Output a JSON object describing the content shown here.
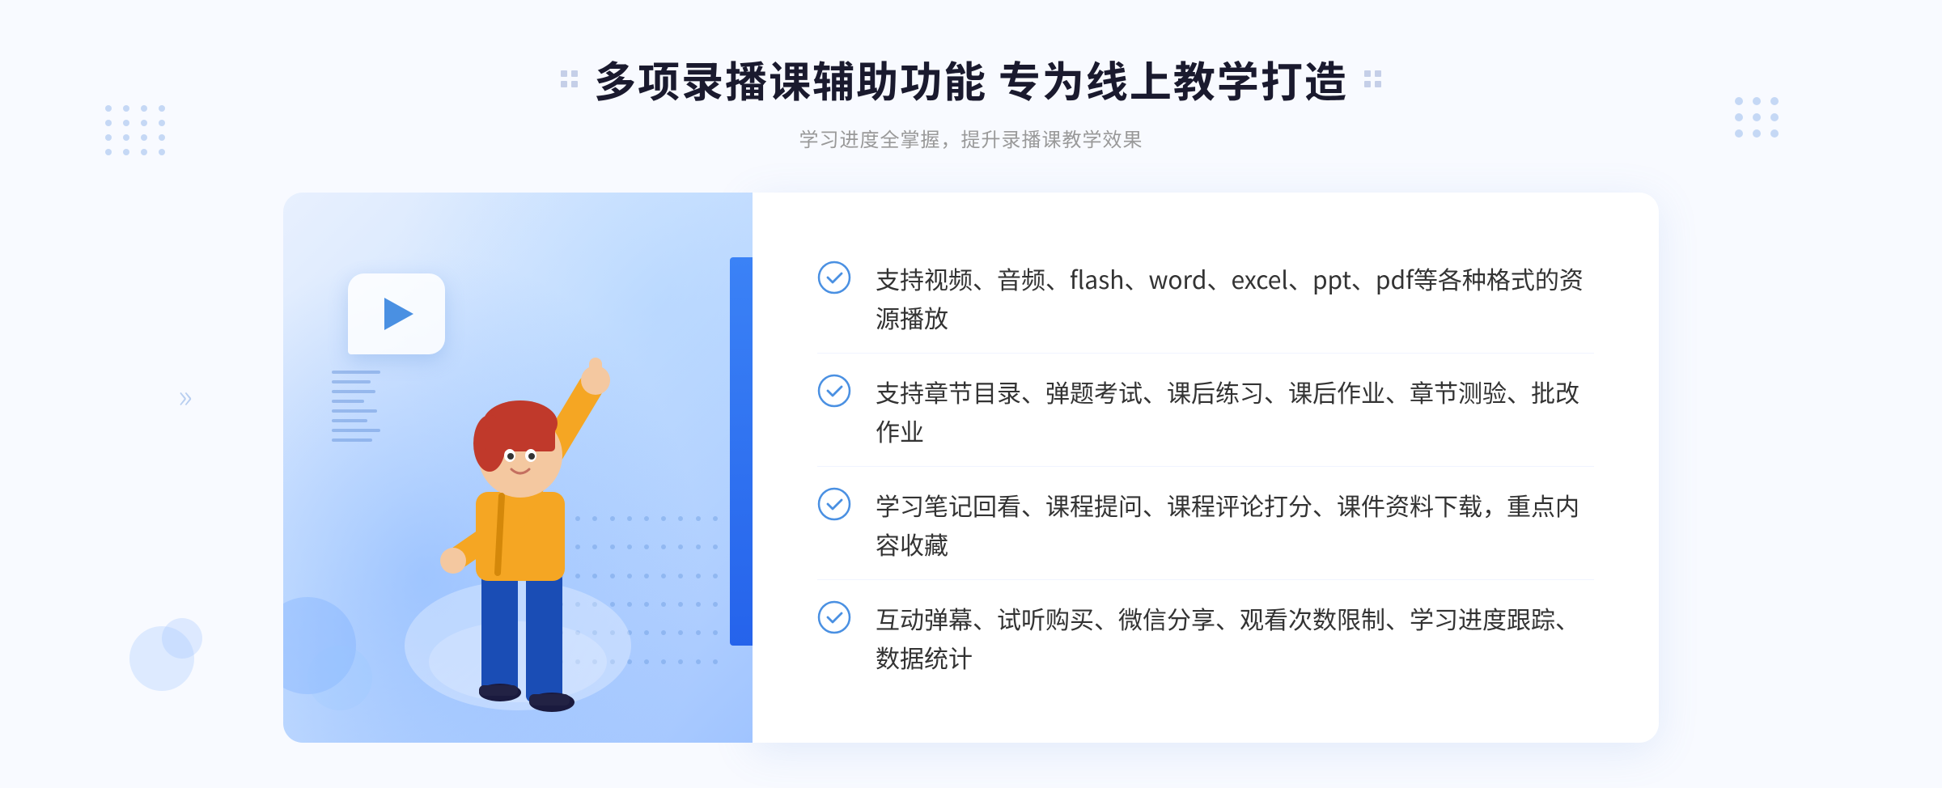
{
  "page": {
    "background": "#f8faff"
  },
  "header": {
    "title": "多项录播课辅助功能 专为线上教学打造",
    "subtitle": "学习进度全掌握，提升录播课教学效果"
  },
  "features": [
    {
      "id": "feature-1",
      "text": "支持视频、音频、flash、word、excel、ppt、pdf等各种格式的资源播放"
    },
    {
      "id": "feature-2",
      "text": "支持章节目录、弹题考试、课后练习、课后作业、章节测验、批改作业"
    },
    {
      "id": "feature-3",
      "text": "学习笔记回看、课程提问、课程评论打分、课件资料下载，重点内容收藏"
    },
    {
      "id": "feature-4",
      "text": "互动弹幕、试听购买、微信分享、观看次数限制、学习进度跟踪、数据统计"
    }
  ],
  "icons": {
    "check": "check-circle-icon",
    "play": "play-icon",
    "left-arrows": "left-chevron-icon",
    "right-dots": "decorative-dots-right"
  },
  "colors": {
    "accent": "#3b82f6",
    "text_primary": "#1a1a2e",
    "text_secondary": "#666",
    "text_light": "#999",
    "check_color": "#4a90e2",
    "panel_bg": "#ffffff",
    "illustration_bg_start": "#e8f0fe",
    "illustration_bg_end": "#a0c4ff"
  }
}
